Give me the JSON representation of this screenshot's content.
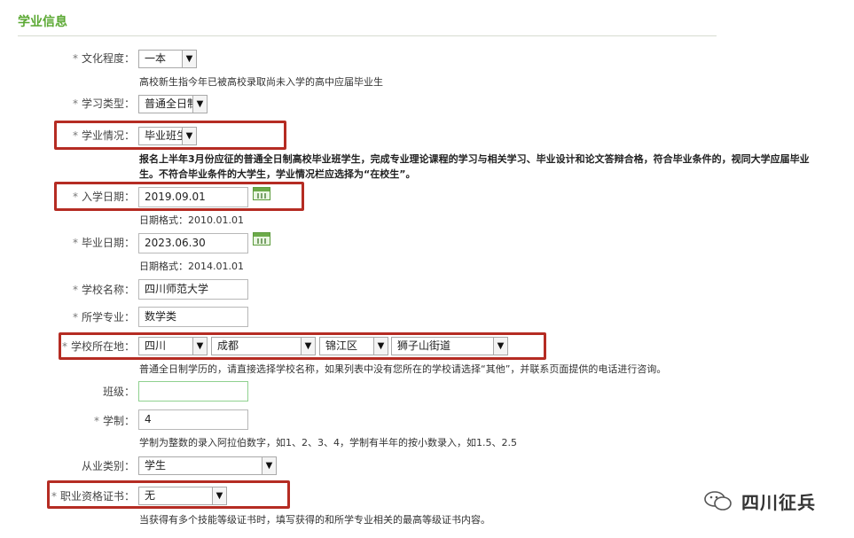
{
  "section_title": "学业信息",
  "fields": {
    "education_level": {
      "label": "文化程度：",
      "value": "一本",
      "hint": "高校新生指今年已被高校录取尚未入学的高中应届毕业生"
    },
    "study_type": {
      "label": "学习类型：",
      "value": "普通全日制"
    },
    "study_status": {
      "label": "学业情况：",
      "value": "毕业班生",
      "hint_line1": "报名上半年3月份应征的普通全日制高校毕业班学生，完成专业理论课程的学习与相关学习、毕业设计和论文答辩合格，符合毕业条件的，视同大学应届毕业",
      "hint_line2": "生。不符合毕业条件的大学生，学业情况栏应选择为“在校生”。"
    },
    "enroll_date": {
      "label": "入学日期：",
      "value": "2019.09.01",
      "hint": "日期格式：2010.01.01"
    },
    "grad_date": {
      "label": "毕业日期：",
      "value": "2023.06.30",
      "hint": "日期格式：2014.01.01"
    },
    "school_name": {
      "label": "学校名称：",
      "value": "四川师范大学"
    },
    "major": {
      "label": "所学专业：",
      "value": "数学类"
    },
    "school_location": {
      "label": "学校所在地：",
      "province": "四川",
      "city": "成都",
      "district": "锦江区",
      "street": "狮子山街道",
      "hint": "普通全日制学历的，请直接选择学校名称，如果列表中没有您所在的学校请选择“其他”，并联系页面提供的电话进行咨询。"
    },
    "class": {
      "label": "班级：",
      "value": ""
    },
    "duration": {
      "label": "学制：",
      "value": "4",
      "hint": "学制为整数的录入阿拉伯数字，如1、2、3、4，学制有半年的按小数录入，如1.5、2.5"
    },
    "job_category": {
      "label": "从业类别：",
      "value": "学生"
    },
    "vocational_cert": {
      "label": "职业资格证书：",
      "value": "无",
      "hint": "当获得有多个技能等级证书时，填写获得的和所学专业相关的最高等级证书内容。"
    }
  },
  "watermark": {
    "text": "四川征兵"
  },
  "colors": {
    "accent_green": "#5aa832",
    "highlight_red": "#b52c23"
  },
  "icons": {
    "calendar": "calendar-icon",
    "dropdown": "chevron-down-icon",
    "watermark": "wechat-logo-icon"
  }
}
